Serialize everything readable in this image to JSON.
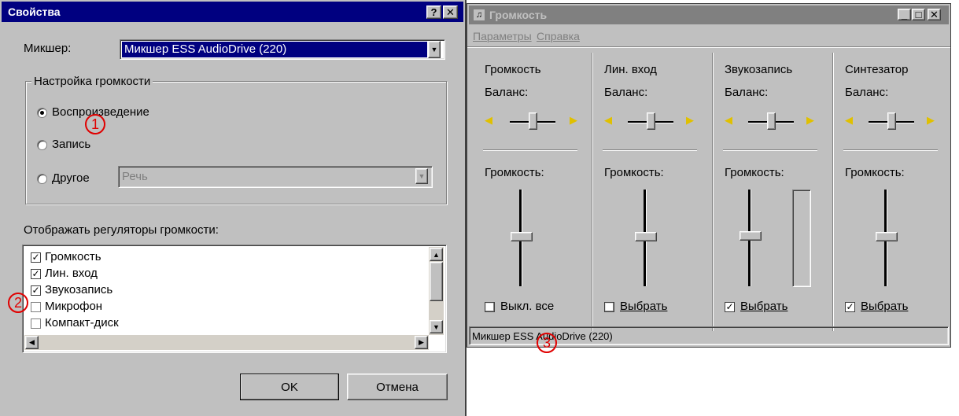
{
  "props": {
    "title": "Свойства",
    "help_btn": "?",
    "close_btn": "✕",
    "mixer_label": "Микшер:",
    "mixer_value": "Микшер ESS AudioDrive (220)",
    "group_title": "Настройка громкости",
    "radio_playback": "Воспроизведение",
    "radio_record": "Запись",
    "radio_other": "Другое",
    "other_value": "Речь",
    "display_label": "Отображать регуляторы громкости:",
    "list_items": [
      {
        "label": "Громкость",
        "checked": true
      },
      {
        "label": "Лин. вход",
        "checked": true
      },
      {
        "label": "Звукозапись",
        "checked": true
      },
      {
        "label": "Микрофон",
        "checked": false
      },
      {
        "label": "Компакт-диск",
        "checked": false
      }
    ],
    "ok_label": "OK",
    "cancel_label": "Отмена"
  },
  "volume": {
    "title": "Громкость",
    "menu_params": "Параметры",
    "menu_help": "Справка",
    "columns": [
      {
        "name": "Громкость",
        "balance": "Баланс:",
        "volume": "Громкость:",
        "check_label": "Выкл. все",
        "checked": false
      },
      {
        "name": "Лин. вход",
        "balance": "Баланс:",
        "volume": "Громкость:",
        "check_label": "Выбрать",
        "checked": false
      },
      {
        "name": "Звукозапись",
        "balance": "Баланс:",
        "volume": "Громкость:",
        "check_label": "Выбрать",
        "checked": true
      },
      {
        "name": "Синтезатор",
        "balance": "Баланс:",
        "volume": "Громкость:",
        "check_label": "Выбрать",
        "checked": true
      }
    ],
    "status": "Микшер ESS AudioDrive (220)"
  },
  "annotations": [
    "1",
    "2",
    "3"
  ],
  "colors": {
    "title_active": "#000080",
    "title_inactive": "#808080",
    "annotation": "#e00000",
    "face": "#c0c0c0"
  }
}
